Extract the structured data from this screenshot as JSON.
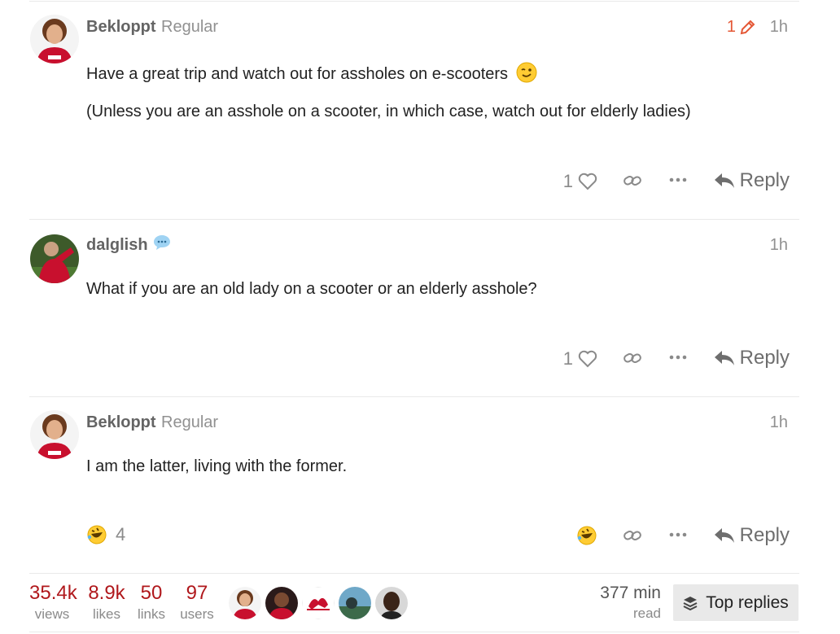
{
  "posts": [
    {
      "username": "Bekloppt",
      "title": "Regular",
      "edit_count": "1",
      "date": "1h",
      "paragraphs": [
        "Have a great trip and watch out for assholes on e-scooters",
        "(Unless you are an asshole on a scooter, in which case, watch out for elderly ladies)"
      ],
      "emoji": "wink",
      "like_count": "1",
      "reply_label": "Reply"
    },
    {
      "username": "dalglish",
      "status_icon": "speech-bubble-icon",
      "date": "1h",
      "paragraphs": [
        "What if you are an old lady on a scooter or an elderly asshole?"
      ],
      "like_count": "1",
      "reply_label": "Reply"
    },
    {
      "username": "Bekloppt",
      "title": "Regular",
      "date": "1h",
      "paragraphs": [
        "I am the latter, living with the former."
      ],
      "reaction": "rofl",
      "reaction_count": "4",
      "reply_label": "Reply"
    }
  ],
  "summary": {
    "views": "35.4k",
    "views_label": "views",
    "likes": "8.9k",
    "likes_label": "likes",
    "links": "50",
    "links_label": "links",
    "users": "97",
    "users_label": "users",
    "read_time": "377 min",
    "read_label": "read",
    "top_replies_label": "Top replies"
  },
  "colors": {
    "accent_red": "#b0181c",
    "edit_orange": "#e45735",
    "muted": "#919191"
  }
}
